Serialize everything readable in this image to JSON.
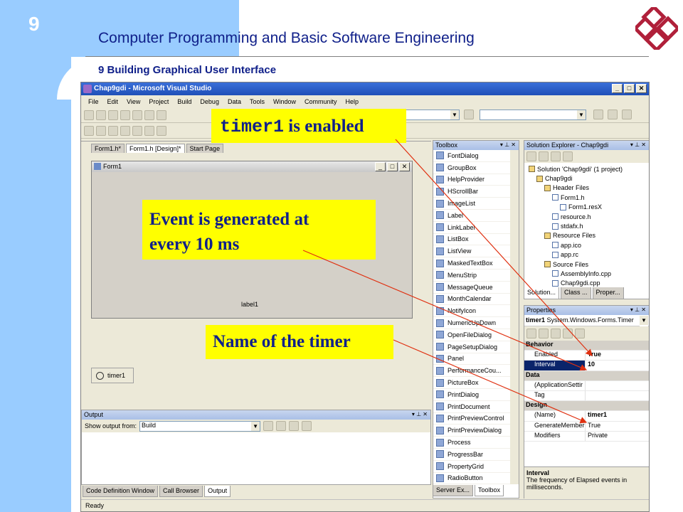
{
  "slide": {
    "number": "9",
    "title": "Computer Programming and Basic Software Engineering",
    "subtitle": "9 Building Graphical User Interface"
  },
  "app": {
    "title": "Chap9gdi - Microsoft Visual Studio",
    "menu": [
      "File",
      "Edit",
      "View",
      "Project",
      "Build",
      "Debug",
      "Data",
      "Tools",
      "Window",
      "Community",
      "Help"
    ]
  },
  "editor_tabs": [
    "Form1.h*",
    "Form1.h [Design]*",
    "Start Page"
  ],
  "form": {
    "title": "Form1",
    "label": "label1"
  },
  "tray": {
    "component": "timer1"
  },
  "output": {
    "title": "Output",
    "show_from_label": "Show output from:",
    "show_from_value": "Build"
  },
  "bottom_tabs": [
    "Code Definition Window",
    "Call Browser",
    "Output"
  ],
  "status": "Ready",
  "toolbox": {
    "title": "Toolbox",
    "items": [
      "FontDialog",
      "GroupBox",
      "HelpProvider",
      "HScrollBar",
      "ImageList",
      "Label",
      "LinkLabel",
      "ListBox",
      "ListView",
      "MaskedTextBox",
      "MenuStrip",
      "MessageQueue",
      "MonthCalendar",
      "NotifyIcon",
      "NumericUpDown",
      "OpenFileDialog",
      "PageSetupDialog",
      "Panel",
      "PerformanceCou...",
      "PictureBox",
      "PrintDialog",
      "PrintDocument",
      "PrintPreviewControl",
      "PrintPreviewDialog",
      "Process",
      "ProgressBar",
      "PropertyGrid",
      "RadioButton"
    ],
    "tabs": [
      "Server Ex...",
      "Toolbox"
    ]
  },
  "solution_explorer": {
    "title": "Solution Explorer - Chap9gdi",
    "tree": [
      {
        "text": "Solution 'Chap9gdi' (1 project)",
        "level": 0,
        "kind": "sol"
      },
      {
        "text": "Chap9gdi",
        "level": 1,
        "kind": "proj"
      },
      {
        "text": "Header Files",
        "level": 2,
        "kind": "folder"
      },
      {
        "text": "Form1.h",
        "level": 3,
        "kind": "file"
      },
      {
        "text": "Form1.resX",
        "level": 4,
        "kind": "file"
      },
      {
        "text": "resource.h",
        "level": 3,
        "kind": "file"
      },
      {
        "text": "stdafx.h",
        "level": 3,
        "kind": "file"
      },
      {
        "text": "Resource Files",
        "level": 2,
        "kind": "folder"
      },
      {
        "text": "app.ico",
        "level": 3,
        "kind": "file"
      },
      {
        "text": "app.rc",
        "level": 3,
        "kind": "file"
      },
      {
        "text": "Source Files",
        "level": 2,
        "kind": "folder"
      },
      {
        "text": "AssemblyInfo.cpp",
        "level": 3,
        "kind": "file"
      },
      {
        "text": "Chap9gdi.cpp",
        "level": 3,
        "kind": "file"
      }
    ],
    "tabs": [
      "Solution...",
      "Class ...",
      "Proper..."
    ]
  },
  "properties": {
    "title": "Properties",
    "object": "timer1",
    "object_type": "System.Windows.Forms.Timer",
    "rows": [
      {
        "cat": true,
        "k": "Behavior"
      },
      {
        "k": "Enabled",
        "v": "True",
        "bold": true
      },
      {
        "k": "Interval",
        "v": "10",
        "bold": true,
        "selected": true
      },
      {
        "cat": true,
        "k": "Data"
      },
      {
        "k": "(ApplicationSettir",
        "v": "",
        "expander": true
      },
      {
        "k": "Tag",
        "v": ""
      },
      {
        "cat": true,
        "k": "Design"
      },
      {
        "k": "(Name)",
        "v": "timer1",
        "bold": true
      },
      {
        "k": "GenerateMember",
        "v": "True"
      },
      {
        "k": "Modifiers",
        "v": "Private"
      }
    ],
    "desc_title": "Interval",
    "desc_text": "The frequency of Elapsed events in milliseconds."
  },
  "callouts": {
    "c1_code": "timer1",
    "c1_text": " is enabled",
    "c2_line1": "Event is generated at",
    "c2_line2": "every 10 ms",
    "c3": "Name of the timer"
  },
  "colors": {
    "accent": "#10208a",
    "callout_bg": "#ffff00",
    "arrow": "#e03010",
    "sidebar": "#99ccff"
  }
}
